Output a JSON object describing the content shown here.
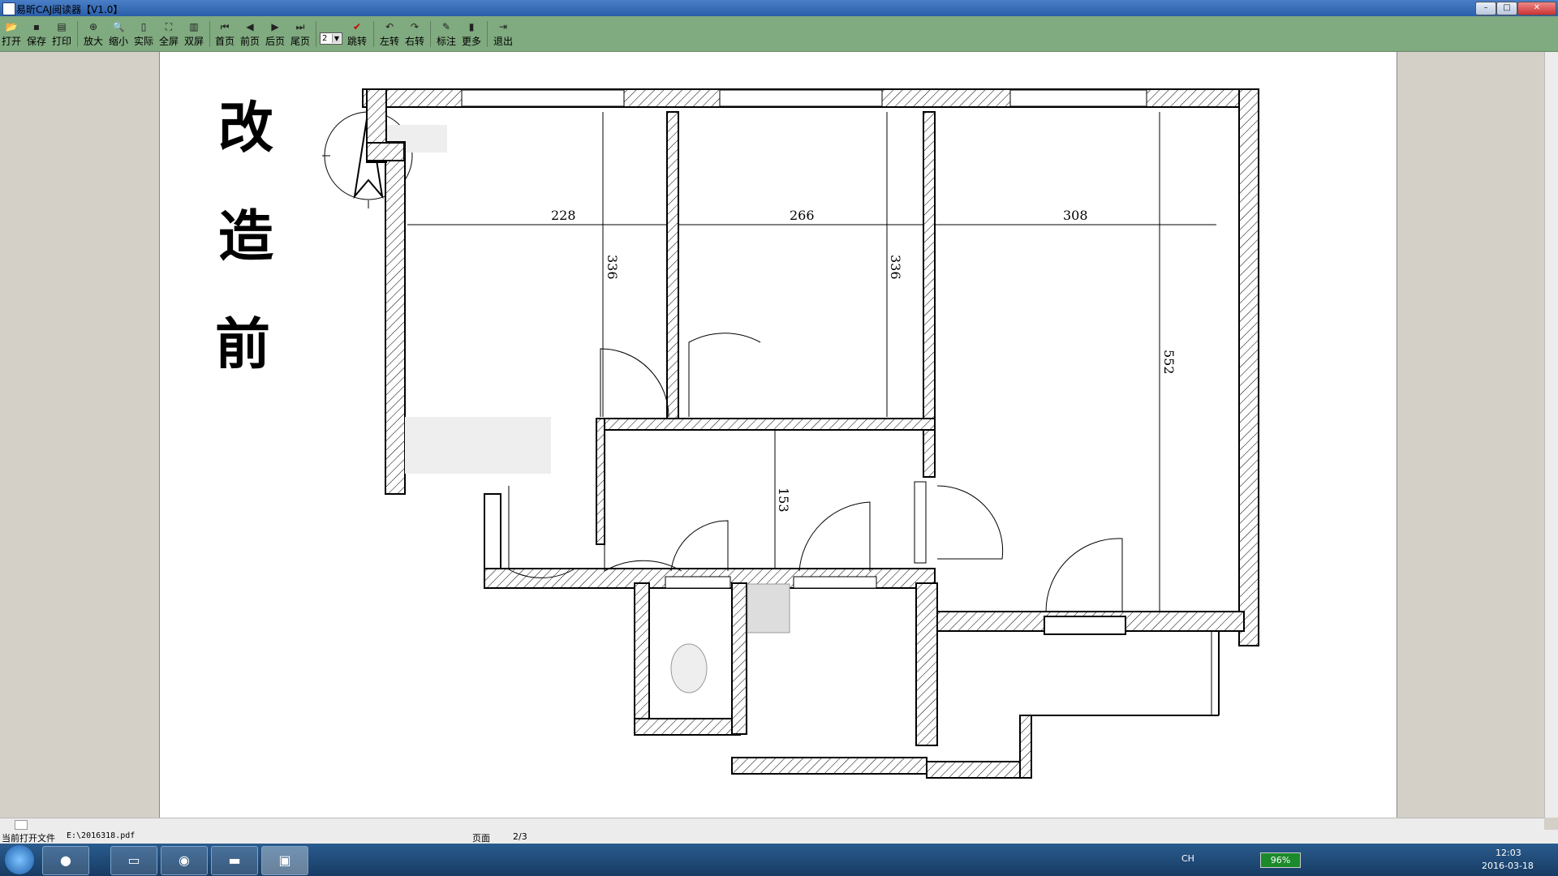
{
  "window": {
    "title": "易昕CAJ阅读器【V1.0】"
  },
  "toolbar": {
    "buttons": [
      {
        "label": "打开",
        "icon": "open-icon"
      },
      {
        "label": "保存",
        "icon": "save-icon"
      },
      {
        "label": "打印",
        "icon": "print-icon"
      },
      {
        "label": "放大",
        "icon": "zoom-in-icon"
      },
      {
        "label": "缩小",
        "icon": "zoom-out-icon"
      },
      {
        "label": "实际",
        "icon": "actual-size-icon"
      },
      {
        "label": "全屏",
        "icon": "fullscreen-icon"
      },
      {
        "label": "双屏",
        "icon": "dual-screen-icon"
      },
      {
        "label": "首页",
        "icon": "first-page-icon"
      },
      {
        "label": "前页",
        "icon": "prev-page-icon"
      },
      {
        "label": "后页",
        "icon": "next-page-icon"
      },
      {
        "label": "尾页",
        "icon": "last-page-icon"
      },
      {
        "label": "跳转",
        "icon": "goto-icon"
      },
      {
        "label": "左转",
        "icon": "rotate-left-icon"
      },
      {
        "label": "右转",
        "icon": "rotate-right-icon"
      },
      {
        "label": "标注",
        "icon": "annotate-icon"
      },
      {
        "label": "更多",
        "icon": "more-icon"
      },
      {
        "label": "退出",
        "icon": "exit-icon"
      }
    ],
    "page_select_value": "2"
  },
  "document": {
    "heading_chars": [
      "改",
      "造",
      "前"
    ],
    "dimensions": {
      "d228": "228",
      "d266": "266",
      "d308": "308",
      "d336a": "336",
      "d336b": "336",
      "d552": "552",
      "d153": "153"
    }
  },
  "statusbar": {
    "file_label": "当前打开文件",
    "file_path": "E:\\2016318.pdf",
    "page_label": "页面",
    "page_value": "2/3"
  },
  "tray": {
    "lang": "CH",
    "battery": "96%",
    "time": "12:03",
    "date": "2016-03-18"
  },
  "colors": {
    "toolbar": "#80aa80",
    "titlebar": "#2a5ea8",
    "taskbar": "#173b63"
  }
}
